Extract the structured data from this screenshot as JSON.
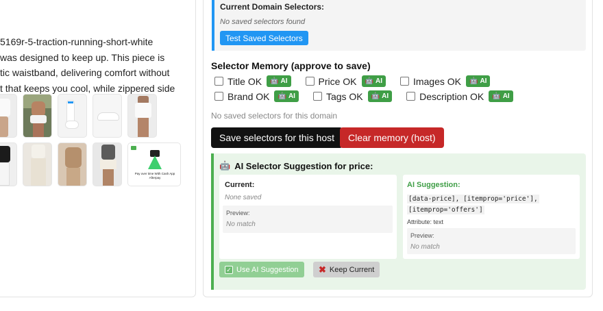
{
  "product": {
    "description_lines": [
      "5169r-5-traction-running-short-white",
      "was designed to keep up. This piece is",
      "tic waistband, delivering comfort without",
      "t that keeps you cool, while zippered side"
    ],
    "thumbnails_row1": [
      "white-shorts-front",
      "model-outdoor",
      "white-socks",
      "white-shoes",
      "white-shorts-model"
    ],
    "thumbnails_row2": [
      "black-top-model",
      "cream-pants",
      "tan-outfit",
      "white-shorts-walk",
      "afterpay-promo"
    ],
    "promo_caption": "Pay over time With Cash App Afterpay"
  },
  "current_selectors": {
    "title": "Current Domain Selectors:",
    "empty_text": "No saved selectors found",
    "test_button": "Test Saved Selectors"
  },
  "memory": {
    "title": "Selector Memory (approve to save)",
    "checks_row1": [
      {
        "label": "Title OK",
        "badge": "AI"
      },
      {
        "label": "Price OK",
        "badge": "AI"
      },
      {
        "label": "Images OK",
        "badge": "AI"
      }
    ],
    "checks_row2": [
      {
        "label": "Brand OK",
        "badge": "AI"
      },
      {
        "label": "Tags OK",
        "badge": "AI"
      },
      {
        "label": "Description OK",
        "badge": "AI"
      }
    ],
    "no_saved": "No saved selectors for this domain",
    "save_button": "Save selectors for this host",
    "clear_button": "Clear memory (host)"
  },
  "suggestion": {
    "title": "AI Selector Suggestion for price:",
    "current_label": "Current:",
    "current_value": "None saved",
    "preview_label": "Preview:",
    "preview_value": "No match",
    "ai_label": "AI Suggestion:",
    "ai_code_line1": "[data-price], [itemprop='price'],",
    "ai_code_line2": "[itemprop='offers']",
    "attribute": "Attribute: text",
    "ai_preview_label": "Preview:",
    "ai_preview_value": "No match",
    "use_button": "Use AI Suggestion",
    "keep_button": "Keep Current"
  },
  "colors": {
    "accent_blue": "#2196f3",
    "ai_green": "#3f9e46",
    "danger_red": "#c62828",
    "suggest_bg": "#e9f5e9"
  }
}
